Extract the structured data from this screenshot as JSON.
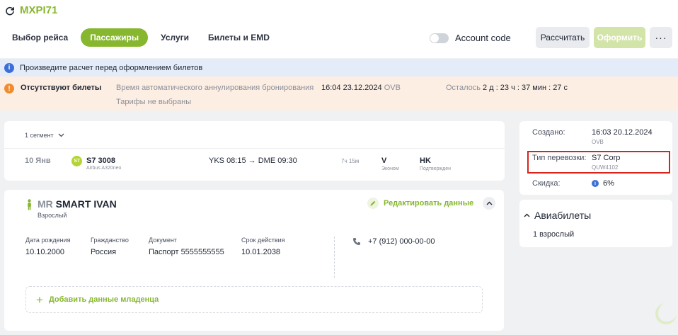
{
  "header": {
    "booking_code": "MXPI71",
    "tabs": [
      {
        "label": "Выбор рейса"
      },
      {
        "label": "Пассажиры"
      },
      {
        "label": "Услуги"
      },
      {
        "label": "Билеты и EMD"
      }
    ],
    "account_code_label": "Account code",
    "calculate_label": "Рассчитать",
    "issue_label": "Оформить",
    "more_label": "···"
  },
  "info_banner": {
    "text": "Произведите расчет перед оформлением билетов"
  },
  "warning_banner": {
    "title": "Отсутствуют билеты",
    "cancel_label": "Время автоматического аннулирования бронирования",
    "cancel_time": "16:04 23.12.2024",
    "cancel_city": "OVB",
    "remaining_label": "Осталось",
    "remaining_value": "2 д : 23 ч : 37 мин : 27 с",
    "tariffs_note": "Тарифы не выбраны"
  },
  "segment": {
    "count_label": "1 сегмент",
    "date": "10 Янв",
    "airline_logo_text": "S7",
    "flight_number": "S7 3008",
    "aircraft": "Airbus A320neo",
    "from": "YKS 08:15",
    "to": "DME 09:30",
    "duration": "7ч 15м",
    "class_code": "V",
    "class_name": "Эконом",
    "status_code": "HK",
    "status_name": "Подтвержден"
  },
  "passenger": {
    "title": "MR",
    "name": "SMART IVAN",
    "type": "Взрослый",
    "edit_label": "Редактировать данные",
    "fields": [
      {
        "label": "Дата рождения",
        "value": "10.10.2000"
      },
      {
        "label": "Гражданство",
        "value": "Россия"
      },
      {
        "label": "Документ",
        "value": "Паспорт 5555555555"
      },
      {
        "label": "Срок действия",
        "value": "10.01.2038"
      }
    ],
    "phone": "+7 (912) 000-00-00",
    "add_infant_label": "Добавить данные младенца"
  },
  "summary": {
    "created_label": "Создано:",
    "created_value": "16:03 20.12.2024",
    "created_city": "OVB",
    "carriage_label": "Тип перевозки:",
    "carriage_value": "S7 Corp",
    "carriage_code": "QUW4102",
    "discount_label": "Скидка:",
    "discount_value": "6%"
  },
  "tickets": {
    "title": "Авиабилеты",
    "summary": "1 взрослый"
  },
  "colors": {
    "brand_green": "#86b72f",
    "info_blue": "#3d6fd9",
    "warning_orange": "#f08c2e",
    "highlight_red": "#d9241c"
  }
}
